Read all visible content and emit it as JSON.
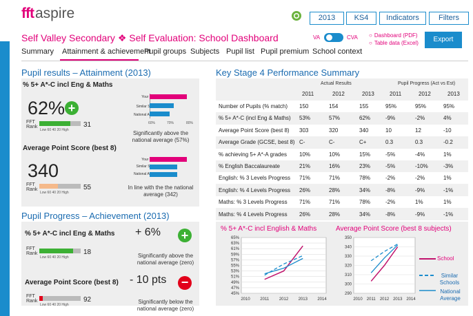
{
  "header": {
    "logo_fft": "fft",
    "logo_text": "aspire",
    "year_button": "2013",
    "stage_button": "KS4",
    "indicators_button": "Indicators",
    "filters_button": "Filters",
    "title": "Self Valley Secondary ❖ Self Evaluation: School Dashboard",
    "va_label": "VA",
    "cva_label": "CVA",
    "link_pdf": "Dashboard (PDF)",
    "link_excel": "Table data (Excel)",
    "export_button": "Export"
  },
  "nav": [
    "Summary",
    "Attainment & achievement",
    "Pupil groups",
    "Subjects",
    "Pupil list",
    "Pupil premium",
    "School context"
  ],
  "pupil_results": {
    "section_title": "Pupil results – Attainment (2013)",
    "m1_label": "% 5+ A*-C incl Eng & Maths",
    "m1_value": "62%",
    "m1_rank": "31",
    "m1_note": "Significantly above the national average (57%)",
    "m2_label": "Average Point Score (best 8)",
    "m2_value": "340",
    "m2_rank": "55",
    "m2_note": "In line with the the national average (342)",
    "bar_labels": [
      "Your School",
      "Similar Schools",
      "National Average"
    ],
    "bar_axis": [
      "60%",
      "70%",
      "80%"
    ],
    "fft_label": "FFT",
    "rank_label": "Rank",
    "rank_axis": "Low  60  40  20  High",
    "m1_bars": [
      0.85,
      0.55,
      0.45
    ],
    "m2_bars": [
      0.85,
      0.62,
      0.62
    ],
    "m1_rank_fill": 0.75,
    "m2_rank_fill": 0.45
  },
  "pupil_progress": {
    "section_title": "Pupil Progress – Achievement (2013)",
    "p1_label": "% 5+ A*-C incl Eng & Maths",
    "p1_value": "+ 6%",
    "p1_rank": "18",
    "p1_note": "Significantly above the national average (zero)",
    "p2_label": "Average Point Score (best 8)",
    "p2_value": "- 10 pts",
    "p2_rank": "92",
    "p2_note": "Significantly below the national average (zero)",
    "p1_rank_fill": 0.82,
    "p2_rank_fill": 0.08
  },
  "ks4": {
    "title": "Key Stage 4 Performance Summary",
    "actual_header": "Actual Results",
    "progress_header": "Pupil Progress (Act vs Est)",
    "years": [
      "2011",
      "2012",
      "2013"
    ],
    "rows": [
      {
        "label": "Number of Pupils (% match)",
        "a": [
          "150",
          "154",
          "155"
        ],
        "p": [
          "95%",
          "95%",
          "95%"
        ]
      },
      {
        "label": "% 5+ A*-C (incl Eng & Maths)",
        "a": [
          "53%",
          "57%",
          "62%"
        ],
        "p": [
          "-9%",
          "-2%",
          "4%"
        ]
      },
      {
        "label": "Average Point Score (best 8)",
        "a": [
          "303",
          "320",
          "340"
        ],
        "p": [
          "10",
          "12",
          "-10"
        ]
      },
      {
        "label": "Average Grade (GCSE, best 8)",
        "a": [
          "C-",
          "C-",
          "C+"
        ],
        "p": [
          "0.3",
          "0.3",
          "-0.2"
        ]
      },
      {
        "label": "% achieving 5+ A*-A grades",
        "a": [
          "10%",
          "10%",
          "15%"
        ],
        "p": [
          "-5%",
          "-4%",
          "1%"
        ]
      },
      {
        "label": "% English Baccalaureate",
        "a": [
          "21%",
          "16%",
          "23%"
        ],
        "p": [
          "-5%",
          "-10%",
          "-3%"
        ]
      },
      {
        "label": "English: % 3 Levels Progress",
        "a": [
          "71%",
          "71%",
          "78%"
        ],
        "p": [
          "-2%",
          "-2%",
          "1%"
        ]
      },
      {
        "label": "English: % 4 Levels Progress",
        "a": [
          "26%",
          "28%",
          "34%"
        ],
        "p": [
          "-8%",
          "-9%",
          "-1%"
        ]
      },
      {
        "label": "Maths: % 3 Levels Progress",
        "a": [
          "71%",
          "71%",
          "78%"
        ],
        "p": [
          "-2%",
          "1%",
          "1%"
        ]
      },
      {
        "label": "Maths: % 4 Levels Progress",
        "a": [
          "26%",
          "28%",
          "34%"
        ],
        "p": [
          "-8%",
          "-9%",
          "-1%"
        ]
      }
    ]
  },
  "colors": {
    "accent": "#e2007a",
    "blue": "#1a8ccc",
    "green": "#3cb034",
    "red": "#e2001a"
  },
  "legend": {
    "school": "School",
    "similar": "Similar Schools",
    "national": "National Average"
  },
  "chart_data": [
    {
      "type": "line",
      "title": "% 5+ A*-C incl English & Maths",
      "x": [
        "2010",
        "2011",
        "2012",
        "2013",
        "2014"
      ],
      "ylim": [
        45,
        65
      ],
      "yticks": [
        "45%",
        "47%",
        "49%",
        "51%",
        "53%",
        "55%",
        "57%",
        "59%",
        "61%",
        "63%",
        "65%"
      ],
      "series": [
        {
          "name": "School",
          "values": [
            null,
            50,
            53,
            62,
            null
          ]
        },
        {
          "name": "Similar Schools",
          "values": [
            null,
            51.5,
            55.5,
            58.5,
            null
          ]
        },
        {
          "name": "National Average",
          "values": [
            null,
            52,
            54,
            57.5,
            null
          ]
        }
      ]
    },
    {
      "type": "line",
      "title": "Average Point Score (best 8 subjects)",
      "x": [
        "2010",
        "2011",
        "2012",
        "2013",
        "2014"
      ],
      "ylim": [
        290,
        350
      ],
      "yticks": [
        "290",
        "300",
        "310",
        "320",
        "330",
        "340",
        "350"
      ],
      "series": [
        {
          "name": "School",
          "values": [
            null,
            303,
            320,
            340,
            null
          ]
        },
        {
          "name": "Similar Schools",
          "values": [
            null,
            325,
            335,
            343,
            null
          ]
        },
        {
          "name": "National Average",
          "values": [
            null,
            312,
            328,
            342,
            null
          ]
        }
      ]
    }
  ]
}
